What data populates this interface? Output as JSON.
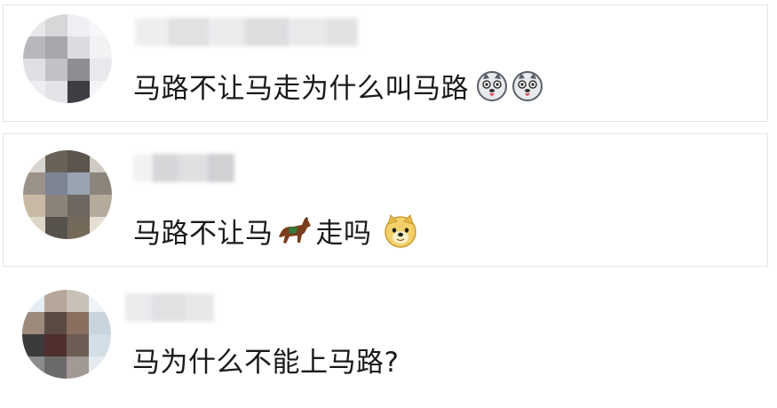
{
  "comments": [
    {
      "text": "马路不让马走为什么叫马路",
      "emojis": [
        "husky-emoji",
        "husky-emoji"
      ]
    },
    {
      "text_before": "马路不让马",
      "text_after": "走吗",
      "emojis_inline": [
        "horse-emoji"
      ],
      "emojis_trailing": [
        "doge-emoji"
      ]
    },
    {
      "text": "马为什么不能上马路?"
    }
  ]
}
